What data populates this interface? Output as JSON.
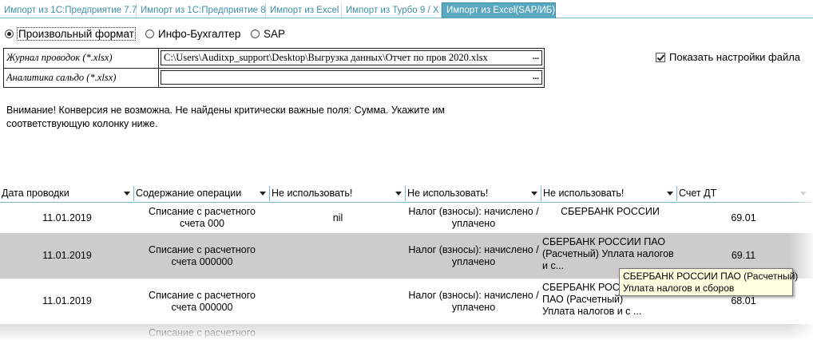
{
  "tabs": [
    {
      "label": "Импорт из 1С:Предприятие 7.7"
    },
    {
      "label": "Импорт из 1С:Предприятие 8"
    },
    {
      "label": "Импорт из Excel"
    },
    {
      "label": "Импорт из Турбо 9 / X"
    },
    {
      "label": "Импорт из Excel(SAP/ИБ)",
      "active": true
    }
  ],
  "format": {
    "options": [
      {
        "label": "Произвольный формат",
        "selected": true
      },
      {
        "label": "Инфо-Бухгалтер",
        "selected": false
      },
      {
        "label": "SAP",
        "selected": false
      }
    ]
  },
  "files": {
    "journal": {
      "label": "Журнал проводок (*.xlsx)",
      "value": "C:\\Users\\Auditxp_support\\Desktop\\Выгрузка данных\\Отчет по пров 2020.xlsx",
      "browse": "..."
    },
    "analytics": {
      "label": "Аналитика сальдо (*.xlsx)",
      "value": "",
      "browse": "..."
    }
  },
  "show_settings": {
    "label": "Показать настройки файла",
    "checked": true
  },
  "warning": {
    "line1": "Внимание! Конверсия не возможна. Не найдены критически важные поля: Сумма. Укажите им",
    "line2": "соответствующую колонку ниже."
  },
  "grid": {
    "columns": [
      "Дата проводки",
      "Содержание операции",
      "Не использовать!",
      "Не использовать!",
      "Не использовать!",
      "Счет ДТ"
    ],
    "rows": [
      {
        "date": "11.01.2019",
        "content": "Списание с расчетного счета 000",
        "c3": "nil",
        "c4": "Налог (взносы): начислено / уплачено",
        "c5": "СБЕРБАНК РОССИИ",
        "dt": "69.01"
      },
      {
        "date": "11.01.2019",
        "content": "Списание с расчетного счета 000000",
        "c3": "",
        "c4": "Налог (взносы): начислено / уплачено",
        "c5": "СБЕРБАНК РОССИИ ПАО (Расчетный) Уплата налогов и с...",
        "dt": "69.11"
      },
      {
        "date": "11.01.2019",
        "content": "Списание с расчетного счета 000000",
        "c3": "",
        "c4": "Налог (взносы): начислено / уплачено",
        "c5": "СБЕРБАНК РОССИИ ПАО (Расчетный) Уплата налогов и с ...",
        "dt": "68.01"
      },
      {
        "date": "",
        "content": "Списание с расчетного",
        "c3": "",
        "c4": "",
        "c5": "",
        "dt": ""
      }
    ]
  },
  "tooltip": {
    "line1": "СБЕРБАНК РОССИИ ПАО (Расчетный)",
    "line2": "Уплата налогов и сборов"
  },
  "colors": {
    "tab_accent": "#5aa8bf",
    "selected_row": "#cccccc",
    "tooltip_bg": "#ffffe1"
  }
}
